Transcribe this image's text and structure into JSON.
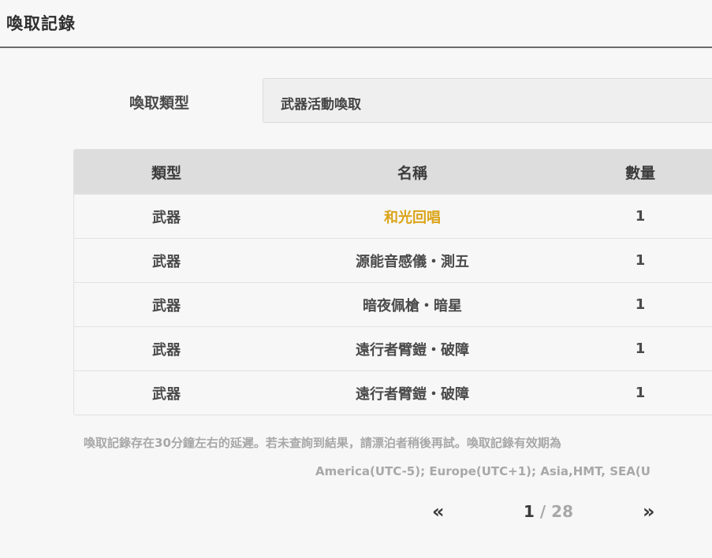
{
  "header": {
    "title": "喚取記錄"
  },
  "filter": {
    "label": "喚取類型",
    "selected": "武器活動喚取"
  },
  "table": {
    "columns": [
      "類型",
      "名稱",
      "數量"
    ],
    "rows": [
      {
        "type": "武器",
        "name": "和光回唱",
        "qty": "1",
        "highlight": true
      },
      {
        "type": "武器",
        "name": "源能音感儀・測五",
        "qty": "1"
      },
      {
        "type": "武器",
        "name": "暗夜佩槍・暗星",
        "qty": "1"
      },
      {
        "type": "武器",
        "name": "遠行者臂鎧・破障",
        "qty": "1"
      },
      {
        "type": "武器",
        "name": "遠行者臂鎧・破障",
        "qty": "1"
      }
    ]
  },
  "colors": {
    "highlight": "#dba419",
    "background": "#f6f7f6"
  },
  "notes": {
    "line1": "喚取記錄存在30分鐘左右的延遲。若未查詢到結果，請漂泊者稍後再試。喚取記錄有效期為",
    "line2": "America(UTC-5); Europe(UTC+1); Asia,HMT, SEA(U"
  },
  "pager": {
    "prev_icon": "«",
    "next_icon": "»",
    "current": "1",
    "separator": " / ",
    "total": "28"
  }
}
